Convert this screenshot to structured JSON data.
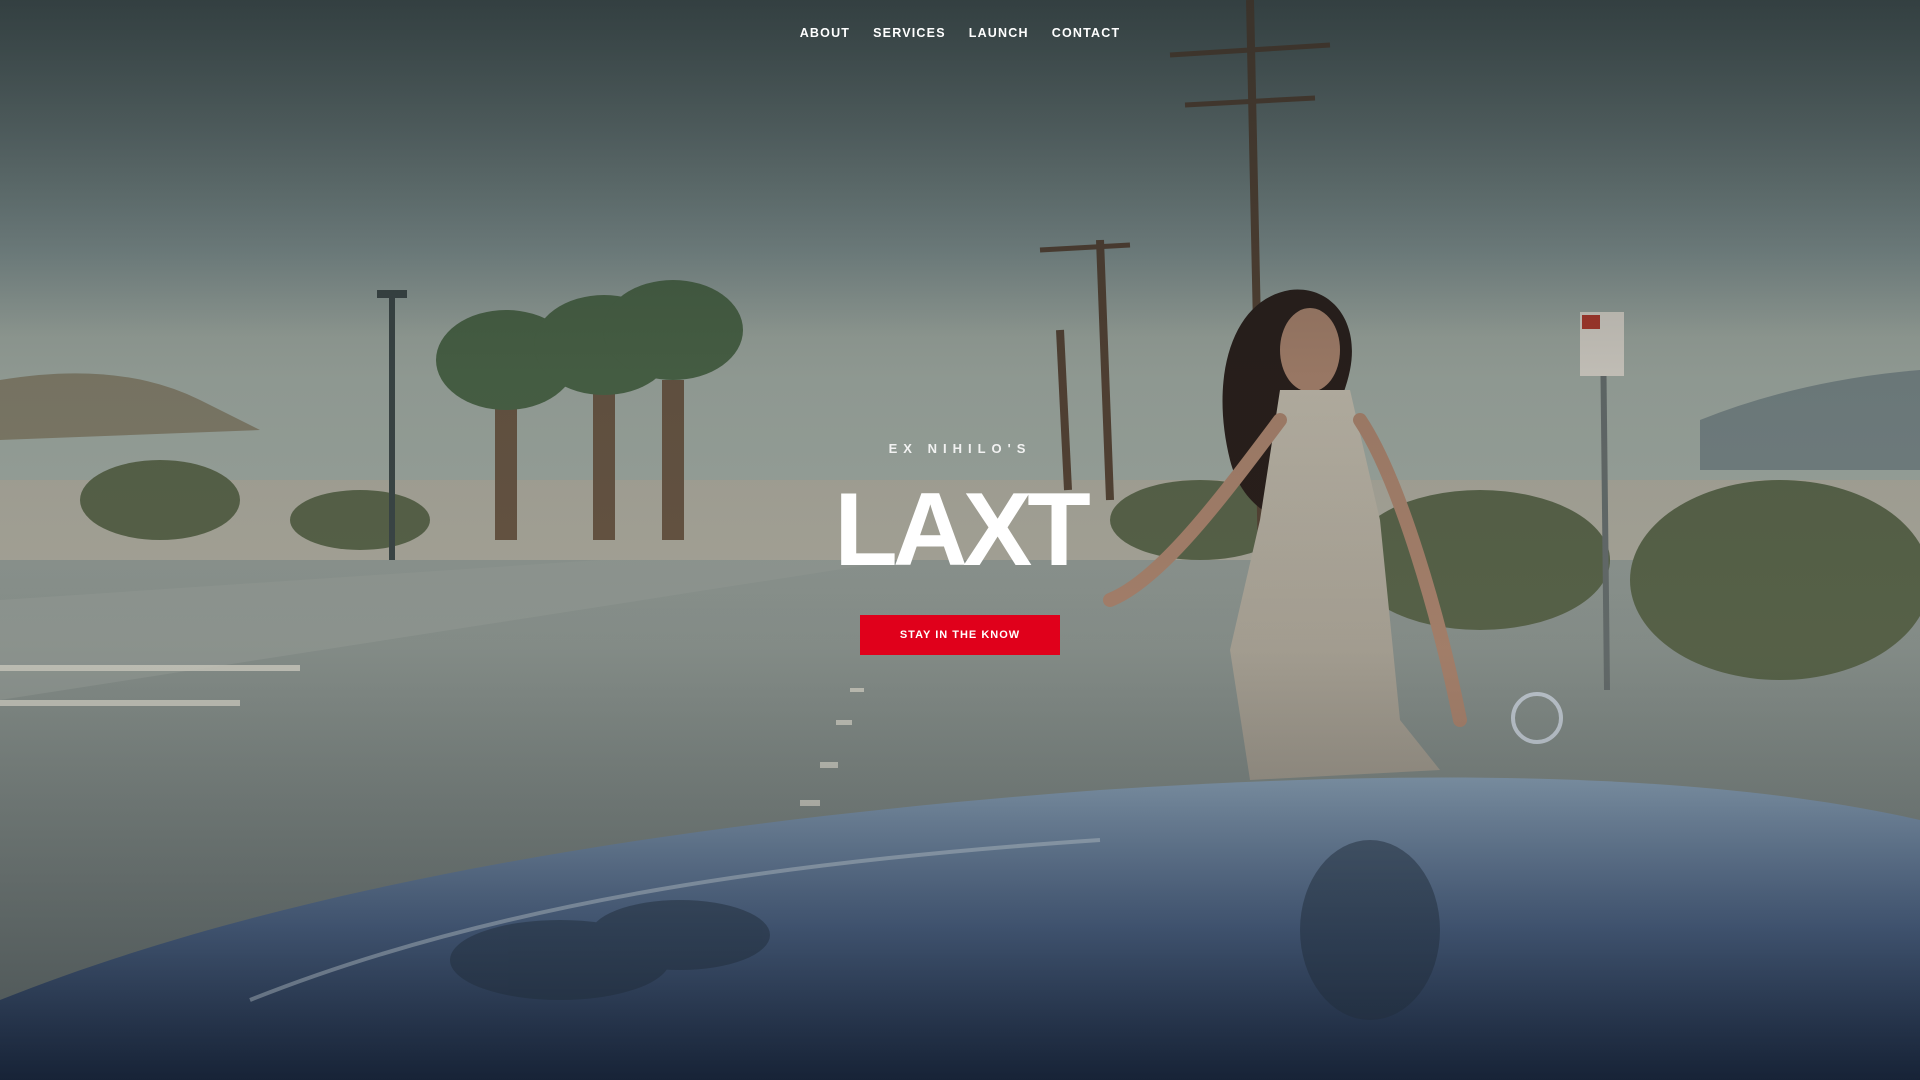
{
  "nav": {
    "items": [
      {
        "label": "ABOUT"
      },
      {
        "label": "SERVICES"
      },
      {
        "label": "LAUNCH"
      },
      {
        "label": "CONTACT"
      }
    ]
  },
  "hero": {
    "eyebrow": "EX NIHILO'S",
    "title": "LAXT",
    "cta_label": "STAY IN THE KNOW"
  },
  "colors": {
    "accent": "#e0001b",
    "text": "#ffffff"
  }
}
